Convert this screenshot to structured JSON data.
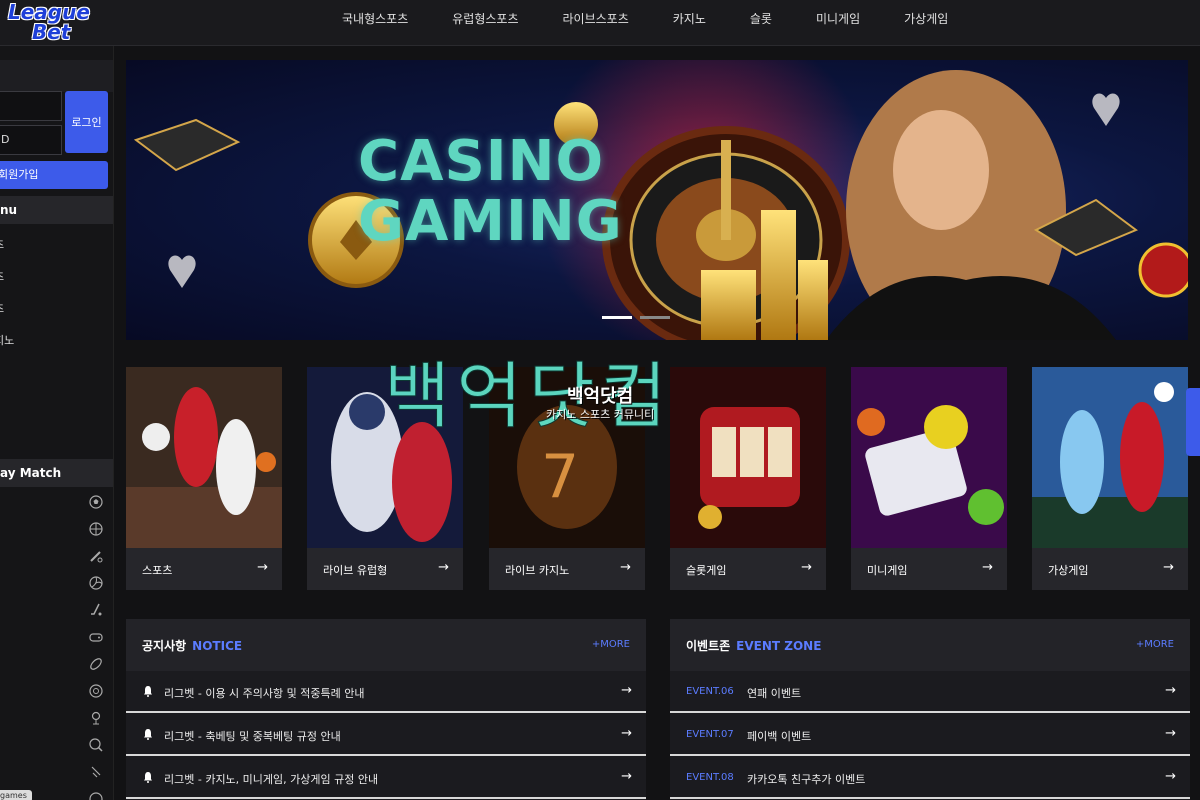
{
  "header": {
    "logo_line1": "League",
    "logo_line2": "Bet",
    "nav": [
      "국내형스포츠",
      "유럽형스포츠",
      "라이브스포츠",
      "카지노",
      "슬롯",
      "미니게임",
      "가상게임"
    ]
  },
  "sidebar": {
    "id_value": "",
    "pw_value": "D",
    "login_label": "로그인",
    "join_label": "회원가입",
    "menu_head": "nu",
    "menu_items": [
      "츠",
      "츠",
      "츠",
      "지노"
    ],
    "play_head": "ay Match",
    "sport_icons": [
      "soccer-icon",
      "basketball-icon",
      "baseball-icon",
      "volleyball-icon",
      "hockey-icon",
      "esports-icon",
      "football-icon",
      "table-tennis-icon",
      "golf-icon",
      "tennis-icon",
      "badminton-icon",
      "more-icon"
    ],
    "tooltip": "games"
  },
  "banner": {
    "line1": "CASINO",
    "line2": "GAMING",
    "slides": 2,
    "active_slide": 0
  },
  "watermark": {
    "big": "백억닷컴",
    "small_title": "백억닷컴",
    "small_sub": "카지노 스포츠 커뮤니티"
  },
  "cards": [
    {
      "label": "스포츠",
      "arrow": "→"
    },
    {
      "label": "라이브 유럽형",
      "arrow": "→"
    },
    {
      "label": "라이브 카지노",
      "arrow": "→"
    },
    {
      "label": "슬롯게임",
      "arrow": "→"
    },
    {
      "label": "미니게임",
      "arrow": "→"
    },
    {
      "label": "가상게임",
      "arrow": "→"
    }
  ],
  "notice": {
    "title_ko": "공지사항",
    "title_en": "NOTICE",
    "more": "+MORE",
    "items": [
      "리그벳 - 이용 시 주의사항 및 적중특례 안내",
      "리그벳 - 축베팅 및 중복베팅 규정 안내",
      "리그벳 - 카지노, 미니게임, 가상게임 규정 안내"
    ]
  },
  "events": {
    "title_ko": "이벤트존",
    "title_en": "EVENT ZONE",
    "more": "+MORE",
    "items": [
      {
        "tag": "EVENT.06",
        "text": "연패 이벤트"
      },
      {
        "tag": "EVENT.07",
        "text": "페이백 이벤트"
      },
      {
        "tag": "EVENT.08",
        "text": "카카오톡 친구추가 이벤트"
      }
    ]
  },
  "colors": {
    "accent": "#3d5bea",
    "accent_text": "#5b7cff",
    "banner_text": "#5fd6c0"
  }
}
